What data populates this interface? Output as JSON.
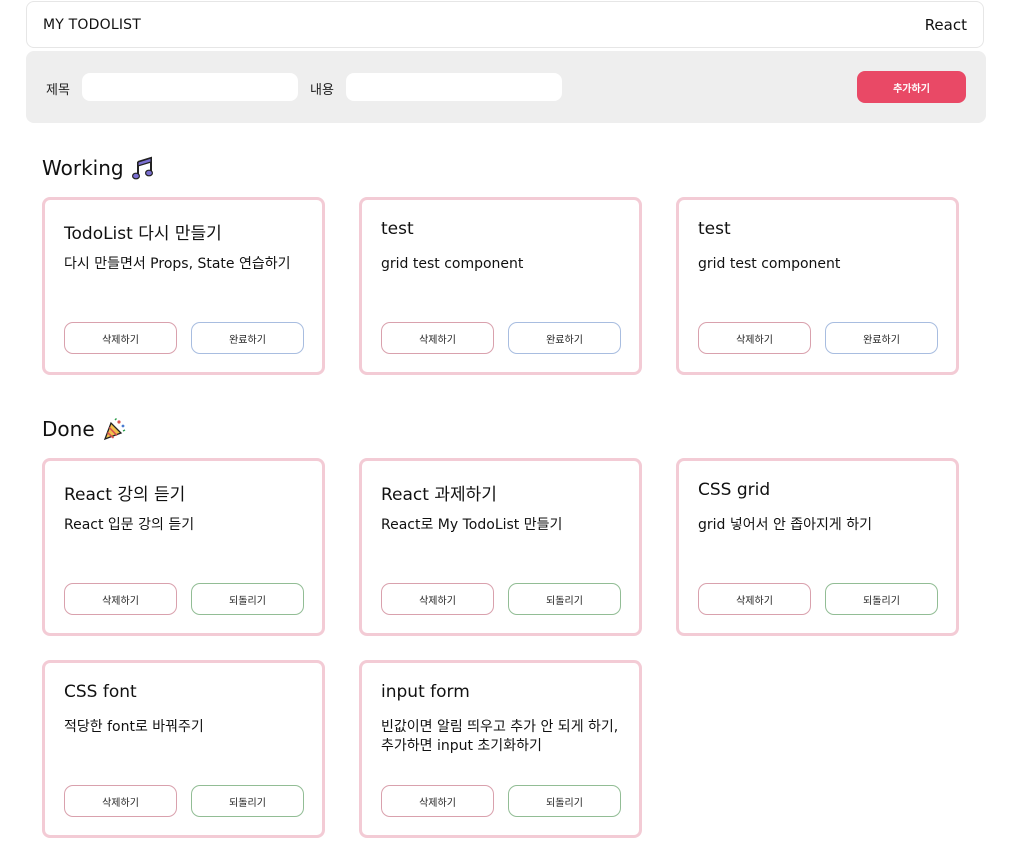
{
  "header": {
    "logo": "MY TODOLIST",
    "stack": "React"
  },
  "form": {
    "title_label": "제목",
    "title_value": "",
    "content_label": "내용",
    "content_value": "",
    "add_label": "추가하기"
  },
  "working": {
    "title": "Working",
    "icon": "music-notes-icon",
    "cards": [
      {
        "title": "TodoList 다시 만들기",
        "body": "다시 만들면서 Props, State 연습하기",
        "delete_label": "삭제하기",
        "action_label": "완료하기"
      },
      {
        "title": "test",
        "body": "grid test component",
        "delete_label": "삭제하기",
        "action_label": "완료하기"
      },
      {
        "title": "test",
        "body": "grid test component",
        "delete_label": "삭제하기",
        "action_label": "완료하기"
      }
    ]
  },
  "done": {
    "title": "Done",
    "icon": "party-popper-icon",
    "cards": [
      {
        "title": "React 강의 듣기",
        "body": "React 입문 강의 듣기",
        "delete_label": "삭제하기",
        "action_label": "되돌리기"
      },
      {
        "title": "React 과제하기",
        "body": "React로 My TodoList 만들기",
        "delete_label": "삭제하기",
        "action_label": "되돌리기"
      },
      {
        "title": "CSS grid",
        "body": "grid 넣어서 안 좁아지게 하기",
        "delete_label": "삭제하기",
        "action_label": "되돌리기"
      },
      {
        "title": "CSS font",
        "body": "적당한 font로 바꿔주기",
        "delete_label": "삭제하기",
        "action_label": "되돌리기"
      },
      {
        "title": "input form",
        "body": "빈값이면 알림 띄우고 추가 안 되게 하기, 추가하면 input 초기화하기",
        "delete_label": "삭제하기",
        "action_label": "되돌리기"
      }
    ]
  },
  "colors": {
    "accent": "#e94966",
    "card_border": "#f3cbd5",
    "delete_border": "#d9a1ad",
    "complete_border": "#a8bde0",
    "undo_border": "#92bd95",
    "form_bg": "#eeeeee"
  }
}
